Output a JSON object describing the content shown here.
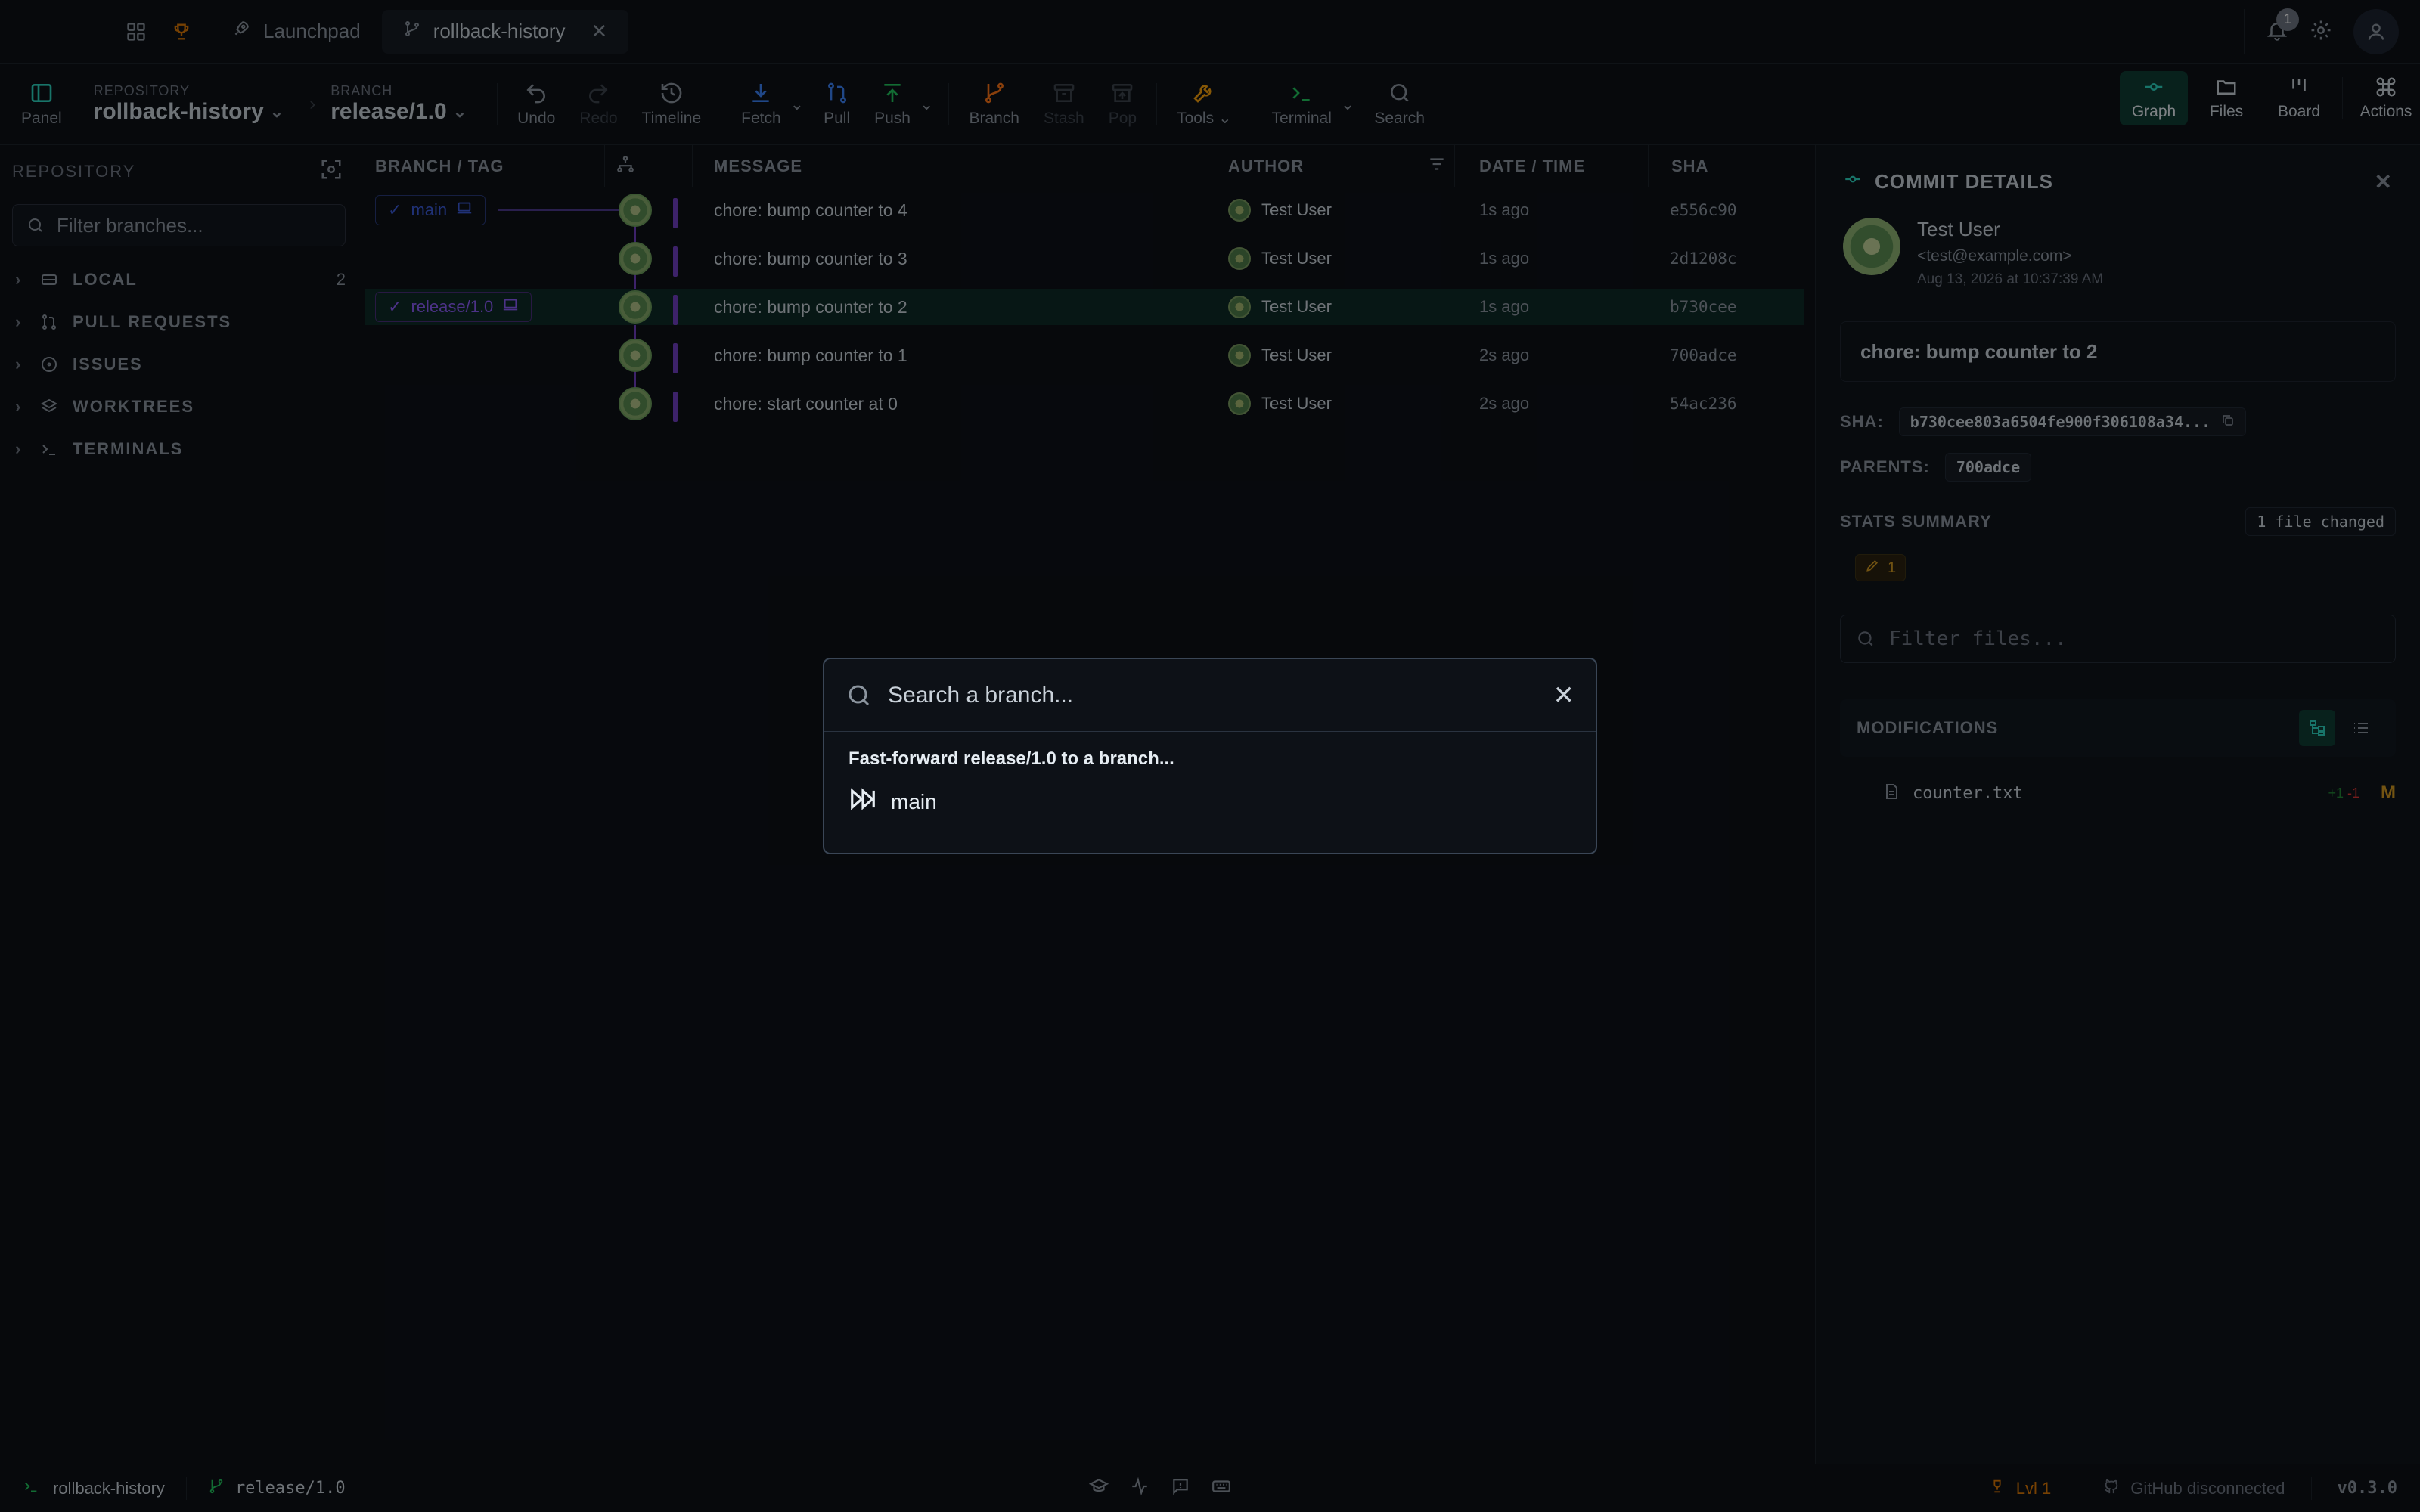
{
  "tabs": {
    "launchpad": "Launchpad",
    "repo_tab": "rollback-history"
  },
  "notifications": {
    "count": "1"
  },
  "toolbar": {
    "panel": "Panel",
    "repository_label": "REPOSITORY",
    "repository_value": "rollback-history",
    "branch_label": "BRANCH",
    "branch_value": "release/1.0",
    "undo": "Undo",
    "redo": "Redo",
    "timeline": "Timeline",
    "fetch": "Fetch",
    "pull": "Pull",
    "push": "Push",
    "branch": "Branch",
    "stash": "Stash",
    "pop": "Pop",
    "tools": "Tools",
    "terminal": "Terminal",
    "search": "Search",
    "graph": "Graph",
    "files": "Files",
    "board": "Board",
    "actions": "Actions"
  },
  "sidebar": {
    "title": "REPOSITORY",
    "filter_placeholder": "Filter branches...",
    "sections": [
      {
        "label": "LOCAL",
        "count": "2"
      },
      {
        "label": "PULL REQUESTS",
        "count": ""
      },
      {
        "label": "ISSUES",
        "count": ""
      },
      {
        "label": "WORKTREES",
        "count": ""
      },
      {
        "label": "TERMINALS",
        "count": ""
      }
    ]
  },
  "graph": {
    "columns": {
      "branch_tag": "BRANCH / TAG",
      "message": "MESSAGE",
      "author": "AUTHOR",
      "date": "DATE / TIME",
      "sha": "SHA"
    },
    "tags": {
      "main": "main",
      "release": "release/1.0"
    },
    "rows": [
      {
        "message": "chore: bump counter to 4",
        "author": "Test User",
        "date": "1s ago",
        "sha": "e556c90"
      },
      {
        "message": "chore: bump counter to 3",
        "author": "Test User",
        "date": "1s ago",
        "sha": "2d1208c"
      },
      {
        "message": "chore: bump counter to 2",
        "author": "Test User",
        "date": "1s ago",
        "sha": "b730cee"
      },
      {
        "message": "chore: bump counter to 1",
        "author": "Test User",
        "date": "2s ago",
        "sha": "700adce"
      },
      {
        "message": "chore: start counter at 0",
        "author": "Test User",
        "date": "2s ago",
        "sha": "54ac236"
      }
    ]
  },
  "details": {
    "title": "COMMIT DETAILS",
    "author_name": "Test User",
    "author_email": "<test@example.com>",
    "author_date": "Aug 13, 2026 at 10:37:39 AM",
    "message": "chore: bump counter to 2",
    "sha_label": "SHA:",
    "sha_value": "b730cee803a6504fe900f306108a34...",
    "parents_label": "PARENTS:",
    "parents_value": "700adce",
    "stats_label": "STATS SUMMARY",
    "stats_value": "1 file changed",
    "stats_mod_count": "1",
    "filter_placeholder": "Filter files...",
    "modifications_label": "MODIFICATIONS",
    "file_name": "counter.txt",
    "file_add": "+1",
    "file_del": "-1",
    "file_status": "M"
  },
  "modal": {
    "placeholder": "Search a branch...",
    "title": "Fast-forward release/1.0 to a branch...",
    "option": "main"
  },
  "statusbar": {
    "repo": "rollback-history",
    "branch": "release/1.0",
    "level": "Lvl 1",
    "github": "GitHub disconnected",
    "version": "v0.3.0"
  },
  "colors": {
    "accent": "#0f3d34",
    "lane": "#6f3fc2",
    "main_tag": "#3b5bdb",
    "release_tag": "#8b5cf6",
    "modified": "#d29922"
  }
}
